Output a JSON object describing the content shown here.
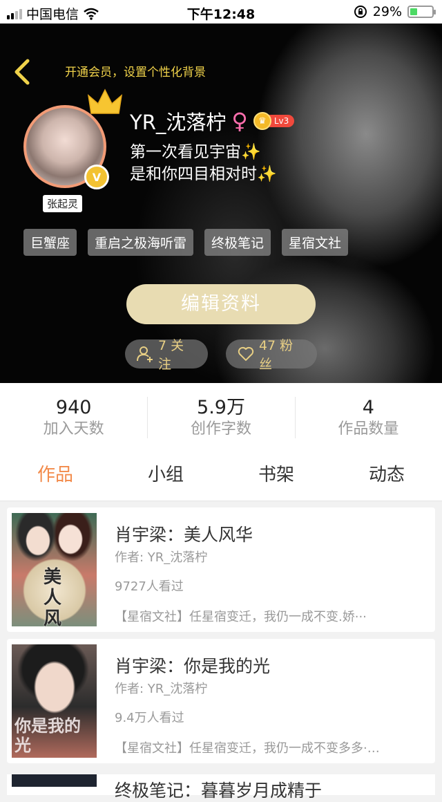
{
  "status_bar": {
    "carrier": "中国电信",
    "time": "下午12:48",
    "battery": "29%"
  },
  "header": {
    "vip_prompt": "开通会员，设置个性化背景",
    "username": "YR_沈落柠",
    "gender_symbol": "♀",
    "level": "Lv3",
    "avatar_badge": "V",
    "avatar_label": "张起灵",
    "bio": [
      "第一次看见宇宙✨",
      "是和你四目相对时✨"
    ],
    "tags": [
      "巨蟹座",
      "重启之极海听雷",
      "终极笔记",
      "星宿文社"
    ],
    "edit_button": "编辑资料",
    "following": "7 关注",
    "followers": "47 粉丝"
  },
  "stats": [
    {
      "value": "940",
      "label": "加入天数"
    },
    {
      "value": "5.9万",
      "label": "创作字数"
    },
    {
      "value": "4",
      "label": "作品数量"
    }
  ],
  "tabs": [
    {
      "label": "作品",
      "active": true
    },
    {
      "label": "小组",
      "active": false
    },
    {
      "label": "书架",
      "active": false
    },
    {
      "label": "动态",
      "active": false
    }
  ],
  "works": [
    {
      "title": "肖宇梁：美人风华",
      "author": "作者: YR_沈落柠",
      "views": "9727人看过",
      "description": "【星宿文社】任星宿变迁，我仍一成不变.娇···",
      "cover_text": "美人风华"
    },
    {
      "title": "肖宇梁：你是我的光",
      "author": "作者: YR_沈落柠",
      "views": "9.4万人看过",
      "description": "【星宿文社】任星宿变迁，我仍一成不变多多·…",
      "cover_text": "你是我的光"
    }
  ],
  "partial_work_title": "终极笔记：暮暮岁月成精于",
  "colors": {
    "accent": "#f28a4a",
    "vip": "#f0d24a",
    "gold_pill": "#e8cf84"
  }
}
